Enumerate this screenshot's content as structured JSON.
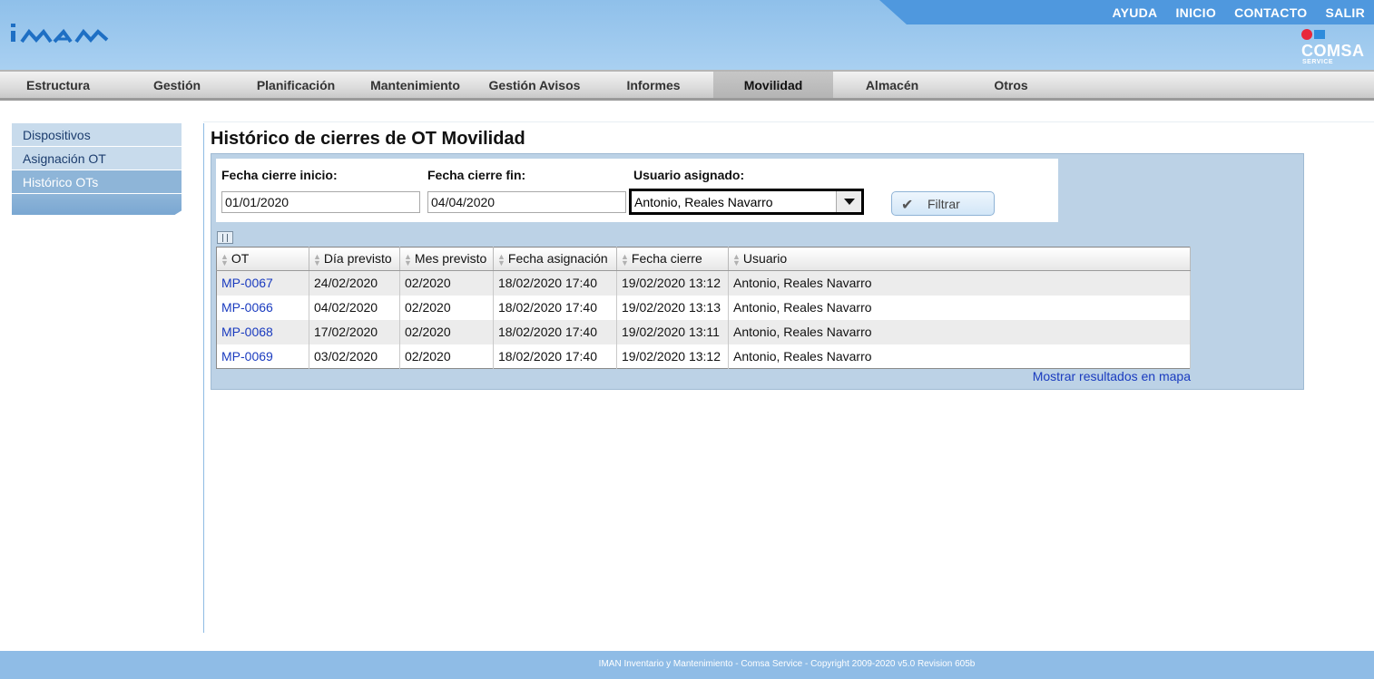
{
  "header": {
    "logo_text": "iman",
    "top_links": [
      "AYUDA",
      "INICIO",
      "CONTACTO",
      "SALIR"
    ],
    "brand_name": "COMSA",
    "brand_sub": "SERVICE"
  },
  "nav": {
    "items": [
      "Estructura",
      "Gestión",
      "Planificación",
      "Mantenimiento",
      "Gestión Avisos",
      "Informes",
      "Movilidad",
      "Almacén",
      "Otros"
    ],
    "active": "Movilidad"
  },
  "sidebar": {
    "items": [
      "Dispositivos",
      "Asignación OT",
      "Histórico OTs"
    ],
    "active": "Histórico OTs"
  },
  "main": {
    "title": "Histórico de cierres de OT Movilidad",
    "filters": {
      "start_label": "Fecha cierre inicio:",
      "start_value": "01/01/2020",
      "end_label": "Fecha cierre fin:",
      "end_value": "04/04/2020",
      "user_label": "Usuario asignado:",
      "user_value": "Antonio, Reales Navarro",
      "button_label": "Filtrar"
    },
    "table": {
      "columns": [
        "OT",
        "Día previsto",
        "Mes previsto",
        "Fecha asignación",
        "Fecha cierre",
        "Usuario"
      ],
      "rows": [
        [
          "MP-0067",
          "24/02/2020",
          "02/2020",
          "18/02/2020 17:40",
          "19/02/2020 13:12",
          "Antonio, Reales Navarro"
        ],
        [
          "MP-0066",
          "04/02/2020",
          "02/2020",
          "18/02/2020 17:40",
          "19/02/2020 13:13",
          "Antonio, Reales Navarro"
        ],
        [
          "MP-0068",
          "17/02/2020",
          "02/2020",
          "18/02/2020 17:40",
          "19/02/2020 13:11",
          "Antonio, Reales Navarro"
        ],
        [
          "MP-0069",
          "03/02/2020",
          "02/2020",
          "18/02/2020 17:40",
          "19/02/2020 13:12",
          "Antonio, Reales Navarro"
        ]
      ]
    },
    "map_link": "Mostrar resultados en mapa"
  },
  "footer": {
    "text": "IMAN Inventario y Mantenimiento - Comsa Service - Copyright 2009-2020 v5.0 Revision 605b"
  },
  "colors": {
    "header_bg": "#a9d0f1",
    "topbar": "#4f98de",
    "link": "#1a3bbf",
    "panel_bg": "#bcd2e6",
    "footer_bg": "#8fbce6"
  }
}
